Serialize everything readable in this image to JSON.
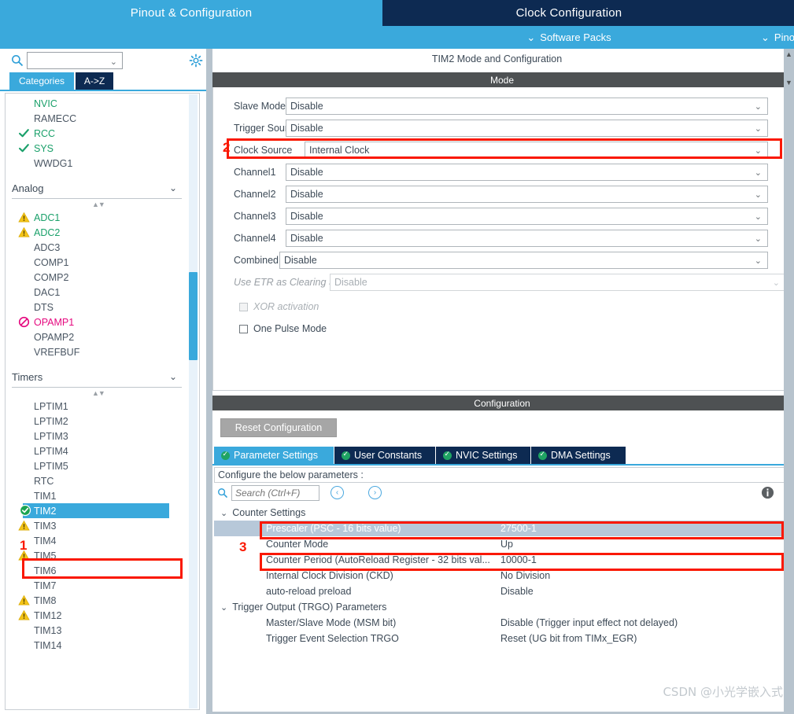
{
  "top_tabs": [
    {
      "label": "Pinout & Configuration",
      "active": true
    },
    {
      "label": "Clock Configuration",
      "active": false
    },
    {
      "label": "",
      "active": false
    }
  ],
  "subbar": {
    "software_packs": "Software Packs",
    "pinout_menu": "Pinout",
    "chevron": "⌄"
  },
  "left_panel": {
    "search_placeholder": "",
    "search_value": "",
    "search_icon": "search-icon",
    "gear_icon": "gear-icon",
    "category_tabs": [
      {
        "label": "Categories",
        "selected": true
      },
      {
        "label": "A->Z",
        "selected": false
      }
    ],
    "tree": {
      "top_items": [
        {
          "label": "NVIC",
          "state": "green",
          "icon": "none"
        },
        {
          "label": "RAMECC",
          "state": "normal",
          "icon": "none"
        },
        {
          "label": "RCC",
          "state": "green",
          "icon": "check"
        },
        {
          "label": "SYS",
          "state": "green",
          "icon": "check"
        },
        {
          "label": "WWDG1",
          "state": "normal",
          "icon": "none"
        }
      ],
      "groups": [
        {
          "title": "Analog",
          "chevron": "⌄",
          "items": [
            {
              "label": "ADC1",
              "state": "green",
              "icon": "warning"
            },
            {
              "label": "ADC2",
              "state": "green",
              "icon": "warning"
            },
            {
              "label": "ADC3",
              "state": "normal",
              "icon": "none"
            },
            {
              "label": "COMP1",
              "state": "normal",
              "icon": "none"
            },
            {
              "label": "COMP2",
              "state": "normal",
              "icon": "none"
            },
            {
              "label": "DAC1",
              "state": "normal",
              "icon": "none"
            },
            {
              "label": "DTS",
              "state": "normal",
              "icon": "none"
            },
            {
              "label": "OPAMP1",
              "state": "pink",
              "icon": "forbidden"
            },
            {
              "label": "OPAMP2",
              "state": "normal",
              "icon": "none"
            },
            {
              "label": "VREFBUF",
              "state": "normal",
              "icon": "none"
            }
          ]
        },
        {
          "title": "Timers",
          "chevron": "⌄",
          "items": [
            {
              "label": "LPTIM1",
              "state": "normal",
              "icon": "none"
            },
            {
              "label": "LPTIM2",
              "state": "normal",
              "icon": "none"
            },
            {
              "label": "LPTIM3",
              "state": "normal",
              "icon": "none"
            },
            {
              "label": "LPTIM4",
              "state": "normal",
              "icon": "none"
            },
            {
              "label": "LPTIM5",
              "state": "normal",
              "icon": "none"
            },
            {
              "label": "RTC",
              "state": "normal",
              "icon": "none"
            },
            {
              "label": "TIM1",
              "state": "normal",
              "icon": "none"
            },
            {
              "label": "TIM2",
              "state": "selected",
              "icon": "check-circle"
            },
            {
              "label": "TIM3",
              "state": "normal",
              "icon": "warning"
            },
            {
              "label": "TIM4",
              "state": "normal",
              "icon": "none"
            },
            {
              "label": "TIM5",
              "state": "normal",
              "icon": "warning"
            },
            {
              "label": "TIM6",
              "state": "normal",
              "icon": "none"
            },
            {
              "label": "TIM7",
              "state": "normal",
              "icon": "none"
            },
            {
              "label": "TIM8",
              "state": "normal",
              "icon": "warning"
            },
            {
              "label": "TIM12",
              "state": "normal",
              "icon": "warning"
            },
            {
              "label": "TIM13",
              "state": "normal",
              "icon": "none"
            },
            {
              "label": "TIM14",
              "state": "normal",
              "icon": "none"
            }
          ]
        }
      ]
    }
  },
  "right_panel": {
    "title": "TIM2 Mode and Configuration",
    "mode_band": "Mode",
    "config_band": "Configuration",
    "mode_fields": [
      {
        "label": "Slave Mode",
        "value": "Disable",
        "disabled": false
      },
      {
        "label": "Trigger Source",
        "value": "Disable",
        "disabled": false
      },
      {
        "label": "Clock Source",
        "value": "Internal Clock",
        "disabled": false
      },
      {
        "label": "Channel1",
        "value": "Disable",
        "disabled": false
      },
      {
        "label": "Channel2",
        "value": "Disable",
        "disabled": false
      },
      {
        "label": "Channel3",
        "value": "Disable",
        "disabled": false
      },
      {
        "label": "Channel4",
        "value": "Disable",
        "disabled": false
      },
      {
        "label": "Combined Channels",
        "value": "Disable",
        "disabled": false
      },
      {
        "label": "Use ETR as Clearing Source",
        "value": "Disable",
        "disabled": true
      }
    ],
    "checkboxes": [
      {
        "label": "XOR activation",
        "checked": false,
        "disabled": true
      },
      {
        "label": "One Pulse Mode",
        "checked": false,
        "disabled": false
      }
    ],
    "reset_button": "Reset Configuration",
    "config_tabs": [
      {
        "label": "Parameter Settings",
        "active": true
      },
      {
        "label": "User Constants",
        "active": false
      },
      {
        "label": "NVIC Settings",
        "active": false
      },
      {
        "label": "DMA Settings",
        "active": false
      }
    ],
    "configure_hint": "Configure the below parameters :",
    "param_search_placeholder": "Search (Ctrl+F)",
    "param_search_value": "",
    "nav_prev": "‹",
    "nav_next": "›",
    "param_rows": [
      {
        "type": "group",
        "name": "Counter Settings",
        "value": "",
        "chevron": "⌄",
        "selected": false
      },
      {
        "type": "param",
        "name": "Prescaler (PSC - 16 bits value)",
        "value": "27500-1",
        "selected": true
      },
      {
        "type": "param",
        "name": "Counter Mode",
        "value": "Up",
        "selected": false
      },
      {
        "type": "param",
        "name": "Counter Period (AutoReload Register - 32 bits val...",
        "value": "10000-1",
        "selected": false
      },
      {
        "type": "param",
        "name": "Internal Clock Division (CKD)",
        "value": "No Division",
        "selected": false
      },
      {
        "type": "param",
        "name": "auto-reload preload",
        "value": "Disable",
        "selected": false
      },
      {
        "type": "group",
        "name": "Trigger Output (TRGO) Parameters",
        "value": "",
        "chevron": "⌄",
        "selected": false
      },
      {
        "type": "param",
        "name": "Master/Slave Mode (MSM bit)",
        "value": "Disable (Trigger input effect not delayed)",
        "selected": false
      },
      {
        "type": "param",
        "name": "Trigger Event Selection TRGO",
        "value": "Reset (UG bit from TIMx_EGR)",
        "selected": false
      }
    ]
  },
  "annotations": [
    {
      "number": "1",
      "target": "tim2-tree-item"
    },
    {
      "number": "2",
      "target": "clock-source-row"
    },
    {
      "number": "3",
      "target": "counter-mode-row"
    }
  ],
  "watermark": "CSDN @小光学嵌入式",
  "colors": {
    "accent_blue": "#3aa9dc",
    "dark_navy": "#0d2a52",
    "band_gray": "#4e5153",
    "annotation_red": "#fa1800",
    "selection_gray_blue": "#b7c8d9",
    "green": "#1aa06a",
    "warning_yellow": "#f5c518",
    "pink": "#e5097f"
  }
}
